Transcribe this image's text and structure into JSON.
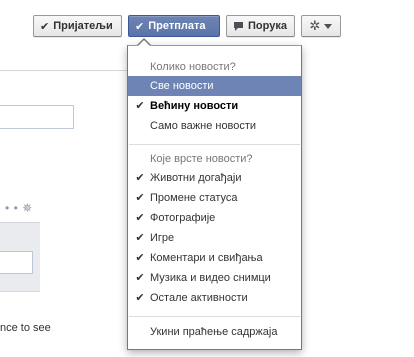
{
  "buttons": {
    "friends": {
      "label": "Пријатељи",
      "icon": "check-icon"
    },
    "subscribe": {
      "label": "Претплата",
      "icon": "check-icon",
      "state": "active",
      "color": "#6d84b4"
    },
    "message": {
      "label": "Порука",
      "icon": "speech-bubble-icon"
    },
    "settings": {
      "icon": "gear-icon"
    }
  },
  "dropdown": {
    "section1": {
      "header": "Колико новости?",
      "items": [
        {
          "label": "Све новости",
          "checked": false,
          "highlighted": true
        },
        {
          "label": "Већину новости",
          "checked": true,
          "bold": true
        },
        {
          "label": "Само важне новости",
          "checked": false
        }
      ]
    },
    "section2": {
      "header": "Које врсте новости?",
      "items": [
        {
          "label": "Животни догађаји",
          "checked": true
        },
        {
          "label": "Промене статуса",
          "checked": true
        },
        {
          "label": "Фотографије",
          "checked": true
        },
        {
          "label": "Игре",
          "checked": true
        },
        {
          "label": "Коментари и свиђања",
          "checked": true
        },
        {
          "label": "Музика и видео снимци",
          "checked": true
        },
        {
          "label": "Остале активности",
          "checked": true
        }
      ]
    },
    "footer": {
      "label": "Укини праћење садржаја"
    }
  },
  "background": {
    "partial_text": "nce to see"
  },
  "colors": {
    "highlight": "#6d84b4",
    "accent": "#3b5998"
  }
}
